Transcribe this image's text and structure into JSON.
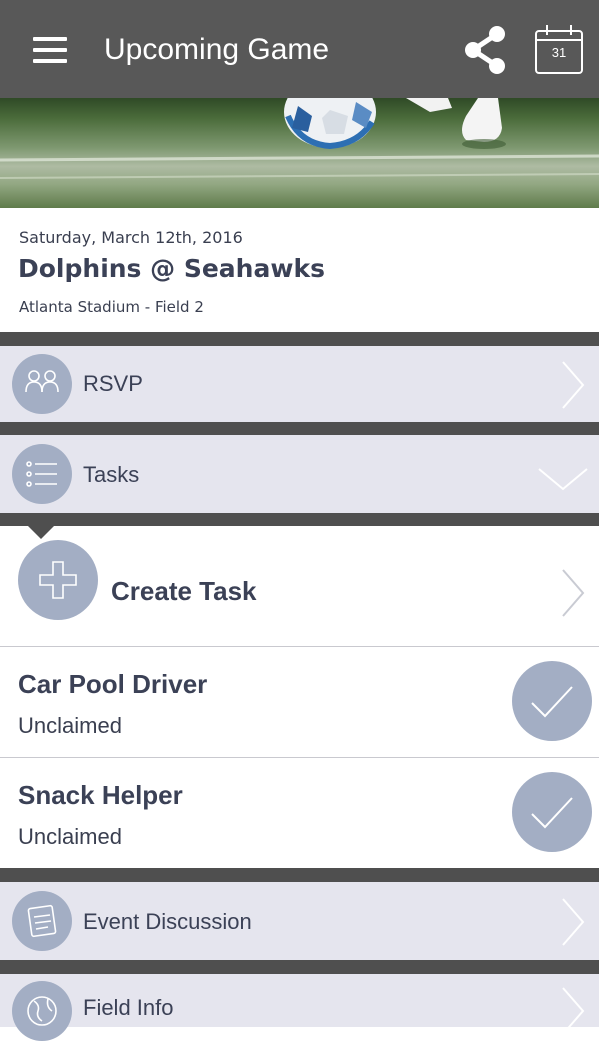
{
  "header": {
    "title": "Upcoming Game",
    "calendar_day": "31",
    "menu_icon": "hamburger-menu-icon",
    "share_icon": "share-icon",
    "calendar_icon": "calendar-icon"
  },
  "event": {
    "date": "Saturday, March 12th, 2016",
    "title": "Dolphins @ Seahawks",
    "location": "Atlanta Stadium - Field 2"
  },
  "sections": {
    "rsvp": {
      "label": "RSVP",
      "icon": "people-icon",
      "state": "collapsed"
    },
    "tasks": {
      "label": "Tasks",
      "icon": "list-icon",
      "state": "expanded"
    },
    "event_discussion": {
      "label": "Event Discussion",
      "icon": "notepad-icon",
      "state": "collapsed"
    },
    "field_info": {
      "label": "Field Info",
      "icon": "globe-icon",
      "state": "collapsed"
    }
  },
  "tasks": {
    "create_label": "Create Task",
    "items": [
      {
        "title": "Car Pool Driver",
        "status": "Unclaimed"
      },
      {
        "title": "Snack Helper",
        "status": "Unclaimed"
      }
    ]
  },
  "colors": {
    "header_bg": "#585858",
    "separator": "#4f4f4f",
    "row_bg": "#e5e5ee",
    "icon_circle": "#a3aec4",
    "text_dark": "#3b4156"
  }
}
